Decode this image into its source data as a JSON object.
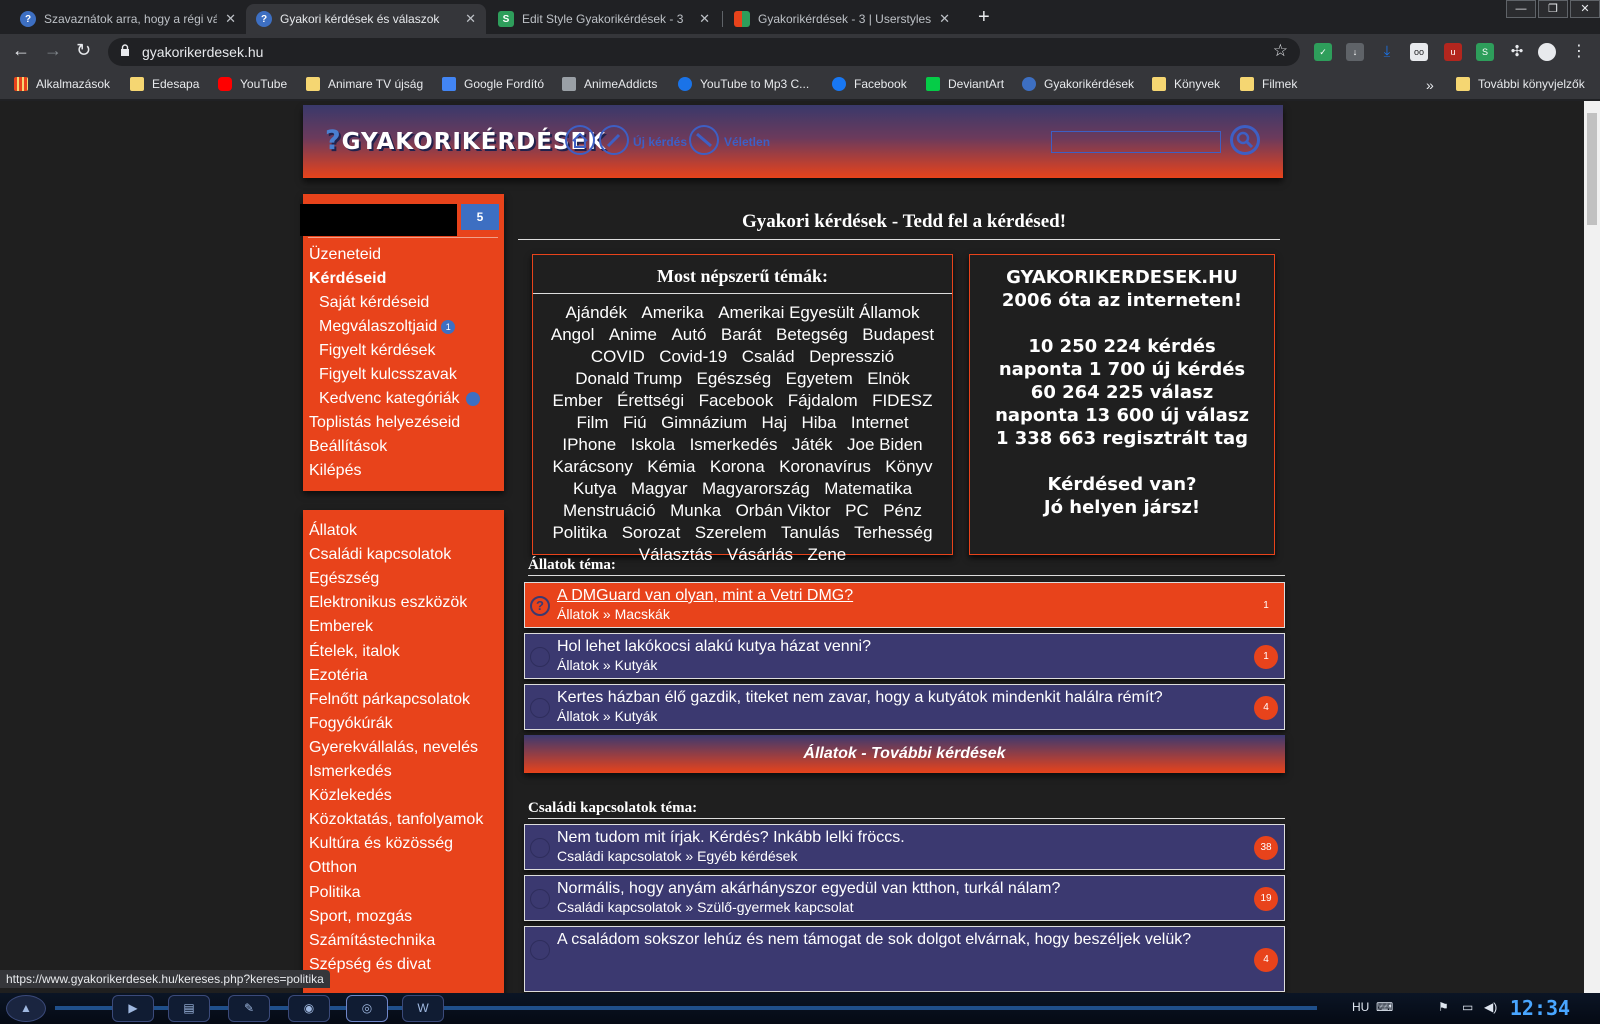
{
  "browser": {
    "tabs": [
      {
        "title": "Szavaznátok arra, hogy a régi vá",
        "icon_color": "#3d6fc2",
        "icon_text": "?"
      },
      {
        "title": "Gyakori kérdések és válaszok",
        "icon_color": "#3d6fc2",
        "icon_text": "?"
      },
      {
        "title": "Edit Style Gyakorikérdések - 3",
        "icon_color": "#2e9e5b",
        "icon_text": "S"
      },
      {
        "title": "Gyakorikérdések - 3 | Userstyles",
        "icon_color": "#e9b12b",
        "icon_text": ""
      }
    ],
    "new_tab": "+",
    "window_buttons": {
      "minimize": "—",
      "restore": "❐",
      "close": "✕"
    },
    "nav": {
      "back": "←",
      "forward": "→",
      "reload": "↻"
    },
    "url": "gyakorikerdesek.hu",
    "bookmarks": [
      {
        "label": "Alkalmazások",
        "icon": "apps-icon",
        "color": "#e8431b"
      },
      {
        "label": "Edesapa",
        "icon": "folder-icon",
        "color": "#f5d672"
      },
      {
        "label": "YouTube",
        "icon": "youtube-icon",
        "color": "#ff0000"
      },
      {
        "label": "Animare TV újság",
        "icon": "tv-icon",
        "color": "#f5d672"
      },
      {
        "label": "Google Fordító",
        "icon": "translate-icon",
        "color": "#4285f4"
      },
      {
        "label": "AnimeAddicts",
        "icon": "anime-icon",
        "color": "#9aa0a6"
      },
      {
        "label": "YouTube to Mp3 C...",
        "icon": "download-icon",
        "color": "#1a73e8"
      },
      {
        "label": "Facebook",
        "icon": "facebook-icon",
        "color": "#1877f2"
      },
      {
        "label": "DeviantArt",
        "icon": "deviantart-icon",
        "color": "#05cc47"
      },
      {
        "label": "Gyakorikérdések",
        "icon": "question-icon",
        "color": "#3d6fc2"
      },
      {
        "label": "Könyvek",
        "icon": "folder-icon",
        "color": "#f5d672"
      },
      {
        "label": "Filmek",
        "icon": "folder-icon",
        "color": "#f5d672"
      }
    ],
    "bookmarks_more": "»",
    "other_bookmarks": "További könyvjelzők",
    "status_url": "https://www.gyakorikerdesek.hu/kereses.php?keres=politika"
  },
  "site": {
    "logo": "GYAKORIKÉRDÉSEK",
    "nav": {
      "new_question": "Új kérdés",
      "random": "Véletlen"
    },
    "user": {
      "badge_count": "5"
    },
    "user_menu": [
      {
        "label": "Üzeneteid",
        "bold": false,
        "indent": false
      },
      {
        "label": "Kérdéseid",
        "bold": true,
        "indent": false
      },
      {
        "label": "Saját kérdéseid",
        "bold": false,
        "indent": true
      },
      {
        "label": "Megválaszoltjaid",
        "bold": false,
        "indent": true,
        "badge": "1"
      },
      {
        "label": "Figyelt kérdések",
        "bold": false,
        "indent": true
      },
      {
        "label": "Figyelt kulcsszavak",
        "bold": false,
        "indent": true
      },
      {
        "label": "Kedvenc kategóriák",
        "bold": false,
        "indent": true,
        "dot": true
      },
      {
        "label": "Toplistás helyezéseid",
        "bold": false,
        "indent": false
      },
      {
        "label": "Beállítások",
        "bold": false,
        "indent": false
      },
      {
        "label": "Kilépés",
        "bold": false,
        "indent": false
      }
    ],
    "categories": [
      "Állatok",
      "Családi kapcsolatok",
      "Egészség",
      "Elektronikus eszközök",
      "Emberek",
      "Ételek, italok",
      "Ezotéria",
      "Felnőtt párkapcsolatok",
      "Fogyókúrák",
      "Gyerekvállalás, nevelés",
      "Ismerkedés",
      "Közlekedés",
      "Közoktatás, tanfolyamok",
      "Kultúra és közösség",
      "Otthon",
      "Politika",
      "Sport, mozgás",
      "Számítástechnika",
      "Szépség és divat"
    ],
    "main_title": "Gyakori kérdések - Tedd fel a kérdésed!",
    "popular_title": "Most népszerű témák:",
    "topics": [
      "Ajándék",
      "Amerika",
      "Amerikai Egyesült Államok",
      "Angol",
      "Anime",
      "Autó",
      "Barát",
      "Betegség",
      "Budapest",
      "COVID",
      "Covid-19",
      "Család",
      "Depresszió",
      "Donald Trump",
      "Egészség",
      "Egyetem",
      "Elnök",
      "Ember",
      "Érettségi",
      "Facebook",
      "Fájdalom",
      "FIDESZ",
      "Film",
      "Fiú",
      "Gimnázium",
      "Haj",
      "Hiba",
      "Internet",
      "IPhone",
      "Iskola",
      "Ismerkedés",
      "Játék",
      "Joe Biden",
      "Karácsony",
      "Kémia",
      "Korona",
      "Koronavírus",
      "Könyv",
      "Kutya",
      "Magyar",
      "Magyarország",
      "Matematika",
      "Menstruáció",
      "Munka",
      "Orbán Viktor",
      "PC",
      "Pénz",
      "Politika",
      "Sorozat",
      "Szerelem",
      "Tanulás",
      "Terhesség",
      "Választás",
      "Vásárlás",
      "Zene"
    ],
    "stats": [
      "GYAKORIKERDESEK.HU",
      "2006 óta az interneten!",
      "",
      "10 250 224 kérdés",
      "naponta 1 700 új kérdés",
      "60 264 225 válasz",
      "naponta 13 600 új válasz",
      "1 338 663 regisztrált tag",
      "",
      "Kérdésed van?",
      "Jó helyen jársz!"
    ],
    "sections": [
      {
        "title": "Állatok téma:",
        "questions": [
          {
            "title": "A DMGuard van olyan, mint a Vetri DMG?",
            "category": "Állatok » Macskák",
            "count": "1",
            "active": true
          },
          {
            "title": "Hol lehet lakókocsi alakú kutya házat venni?",
            "category": "Állatok » Kutyák",
            "count": "1",
            "active": false
          },
          {
            "title": "Kertes házban élő gazdik, titeket nem zavar, hogy a kutyátok mindenkit halálra rémít?",
            "category": "Állatok » Kutyák",
            "count": "4",
            "active": false
          }
        ],
        "more": "Állatok - További kérdések"
      },
      {
        "title": "Családi kapcsolatok téma:",
        "questions": [
          {
            "title": "Nem tudom mit írjak. Kérdés? Inkább lelki fröccs.",
            "category": "Családi kapcsolatok » Egyéb kérdések",
            "count": "38",
            "active": false
          },
          {
            "title": "Normális, hogy anyám akárhányszor egyedül van ktthon, turkál nálam?",
            "category": "Családi kapcsolatok » Szülő-gyermek kapcsolat",
            "count": "19",
            "active": false
          },
          {
            "title": "A családom sokszor lehúz és nem támogat de sok dolgot elvárnak, hogy beszéljek velük?",
            "category": "",
            "count": "4",
            "active": false
          }
        ]
      }
    ]
  },
  "taskbar": {
    "lang": "HU",
    "time": "12:34"
  }
}
